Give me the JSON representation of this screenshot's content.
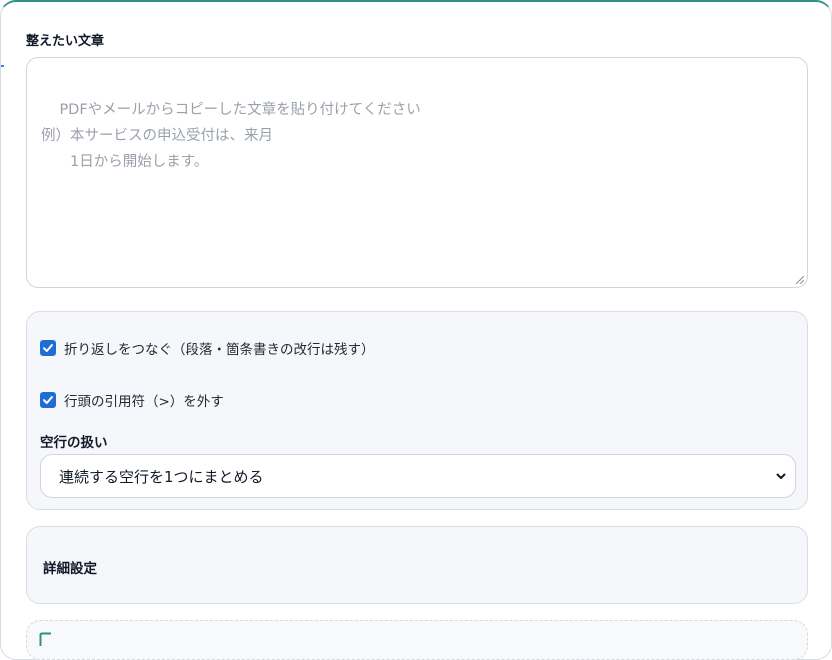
{
  "editor": {
    "label": "整えたい文章",
    "placeholder": "PDFやメールからコピーした文章を貼り付けてください\n例）本サービスの申込受付は、来月\n　　1日から開始します。",
    "value": ""
  },
  "options": {
    "join_lines": {
      "label": "折り返しをつなぐ（段落・箇条書きの改行は残す）",
      "checked": true
    },
    "strip_quotes": {
      "label": "行頭の引用符（>）を外す",
      "checked": true
    },
    "blank_lines": {
      "label": "空行の扱い",
      "selected": "連続する空行を1つにまとめる"
    }
  },
  "details": {
    "title": "詳細設定"
  },
  "colors": {
    "accent": "#2f8f86",
    "checkbox": "#1f6ed4",
    "panel_bg": "#f5f7fa"
  }
}
